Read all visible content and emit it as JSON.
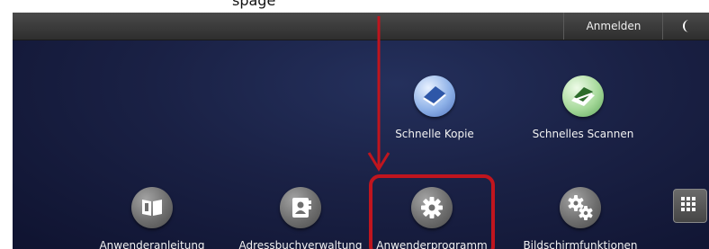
{
  "caption": {
    "text": "spage"
  },
  "topbar": {
    "login_label": "Anmelden",
    "energy_icon": "moon-icon"
  },
  "apps_top": [
    {
      "label": "Schnelle Kopie",
      "icon": "copy-icon",
      "color": "#6a8fd8"
    },
    {
      "label": "Schnelles Scannen",
      "icon": "scanner-icon",
      "color": "#7fc46f"
    }
  ],
  "apps_bottom": [
    {
      "label": "Anwenderanleitung",
      "icon": "book-icon",
      "color": "#7a7a7a"
    },
    {
      "label": "Adressbuchverwaltung",
      "icon": "address-book-icon",
      "color": "#7a7a7a"
    },
    {
      "label": "Anwenderprogramm",
      "icon": "gear-icon",
      "color": "#7a7a7a"
    },
    {
      "label": "Bildschirmfunktionen",
      "icon": "gears-icon",
      "color": "#7a7a7a"
    }
  ],
  "app_grid": {
    "icon": "grid-icon"
  },
  "annotation": {
    "highlight_color": "#c0151e",
    "target": "Anwenderprogramm"
  }
}
